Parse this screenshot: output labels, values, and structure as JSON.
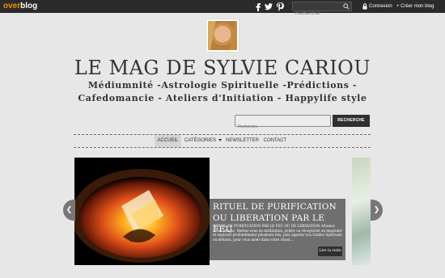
{
  "topbar": {
    "brand_part1": "over",
    "brand_part2": "blog",
    "social_icons": [
      "facebook-icon",
      "twitter-icon",
      "pinterest-icon"
    ],
    "search_placeholder": "Rechercher",
    "login_label": "Connexion",
    "create_label": "+ Créer mon blog"
  },
  "header": {
    "title": "LE MAG DE SYLVIE CARIOU",
    "subtitle": "Médiumnité -Astrologie Spirituelle -Prédictions - Cafedomancie - Ateliers d'Initiation - Happylife style"
  },
  "search": {
    "placeholder": "Recherche",
    "button_label": "RECHERCHE"
  },
  "nav": {
    "items": [
      "ACCUEIL",
      "CATÉGORIES",
      "NEWSLETTER",
      "CONTACT"
    ]
  },
  "slider": {
    "title": "RITUEL DE PURIFICATION OU LIBERATION PAR LE FEU",
    "excerpt": "RITUEL DE PURIFICATION PAR LE FEU OU DE LIBERATION Allumez votre bougie, Mettez-vous en méditation, prière ou réceptivité en inspirant et expirant profondément plusieurs fois, puis appelez vos Guides Spirituels ou défunts, pour vous aider dans votre rituel....",
    "readmore_label": "Lire la suite",
    "prev_symbol": "❮",
    "next_symbol": "❯"
  },
  "colors": {
    "topbar": "#2b2b2b",
    "brand_accent": "#f29400",
    "page_bg": "#e7e7e7",
    "button_dark": "#2f2f2f"
  }
}
